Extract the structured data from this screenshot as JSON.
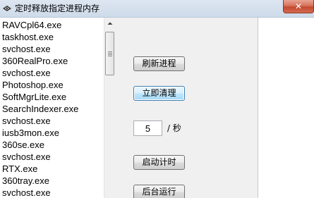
{
  "window": {
    "title": "定时释放指定进程内存",
    "close_glyph": "✕",
    "close_color": "#c8462c"
  },
  "process_list": {
    "items": [
      "RAVCpl64.exe",
      "taskhost.exe",
      "svchost.exe",
      "360RealPro.exe",
      "svchost.exe",
      "Photoshop.exe",
      "SoftMgrLite.exe",
      "SearchIndexer.exe",
      "svchost.exe",
      "iusb3mon.exe",
      "360se.exe",
      "svchost.exe",
      "RTX.exe",
      "360tray.exe",
      "svchost.exe"
    ]
  },
  "controls": {
    "refresh_label": "刷新进程",
    "clear_now_label": "立即清理",
    "interval_value": "5",
    "interval_unit": "/ 秒",
    "start_timer_label": "启动计时",
    "background_run_label": "后台运行"
  }
}
